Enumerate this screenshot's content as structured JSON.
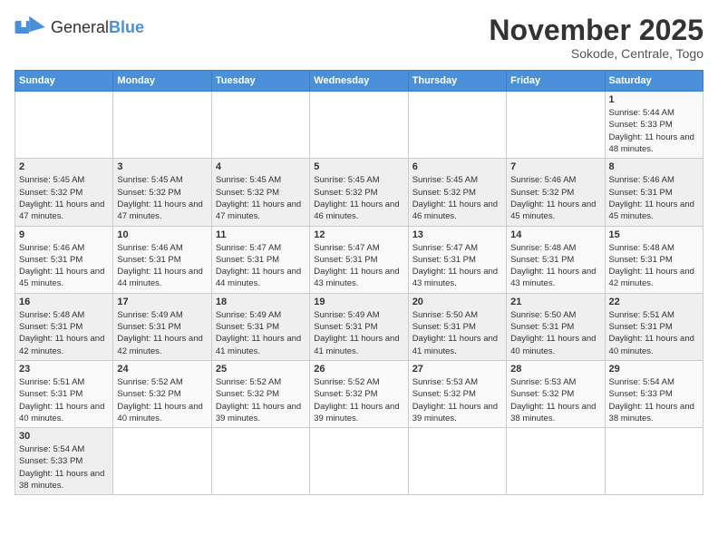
{
  "header": {
    "logo_general": "General",
    "logo_blue": "Blue",
    "month_title": "November 2025",
    "subtitle": "Sokode, Centrale, Togo"
  },
  "days_of_week": [
    "Sunday",
    "Monday",
    "Tuesday",
    "Wednesday",
    "Thursday",
    "Friday",
    "Saturday"
  ],
  "weeks": [
    [
      {
        "day": "",
        "info": ""
      },
      {
        "day": "",
        "info": ""
      },
      {
        "day": "",
        "info": ""
      },
      {
        "day": "",
        "info": ""
      },
      {
        "day": "",
        "info": ""
      },
      {
        "day": "",
        "info": ""
      },
      {
        "day": "1",
        "info": "Sunrise: 5:44 AM\nSunset: 5:33 PM\nDaylight: 11 hours and 48 minutes."
      }
    ],
    [
      {
        "day": "2",
        "info": "Sunrise: 5:45 AM\nSunset: 5:32 PM\nDaylight: 11 hours and 47 minutes."
      },
      {
        "day": "3",
        "info": "Sunrise: 5:45 AM\nSunset: 5:32 PM\nDaylight: 11 hours and 47 minutes."
      },
      {
        "day": "4",
        "info": "Sunrise: 5:45 AM\nSunset: 5:32 PM\nDaylight: 11 hours and 47 minutes."
      },
      {
        "day": "5",
        "info": "Sunrise: 5:45 AM\nSunset: 5:32 PM\nDaylight: 11 hours and 46 minutes."
      },
      {
        "day": "6",
        "info": "Sunrise: 5:45 AM\nSunset: 5:32 PM\nDaylight: 11 hours and 46 minutes."
      },
      {
        "day": "7",
        "info": "Sunrise: 5:46 AM\nSunset: 5:32 PM\nDaylight: 11 hours and 45 minutes."
      },
      {
        "day": "8",
        "info": "Sunrise: 5:46 AM\nSunset: 5:31 PM\nDaylight: 11 hours and 45 minutes."
      }
    ],
    [
      {
        "day": "9",
        "info": "Sunrise: 5:46 AM\nSunset: 5:31 PM\nDaylight: 11 hours and 45 minutes."
      },
      {
        "day": "10",
        "info": "Sunrise: 5:46 AM\nSunset: 5:31 PM\nDaylight: 11 hours and 44 minutes."
      },
      {
        "day": "11",
        "info": "Sunrise: 5:47 AM\nSunset: 5:31 PM\nDaylight: 11 hours and 44 minutes."
      },
      {
        "day": "12",
        "info": "Sunrise: 5:47 AM\nSunset: 5:31 PM\nDaylight: 11 hours and 43 minutes."
      },
      {
        "day": "13",
        "info": "Sunrise: 5:47 AM\nSunset: 5:31 PM\nDaylight: 11 hours and 43 minutes."
      },
      {
        "day": "14",
        "info": "Sunrise: 5:48 AM\nSunset: 5:31 PM\nDaylight: 11 hours and 43 minutes."
      },
      {
        "day": "15",
        "info": "Sunrise: 5:48 AM\nSunset: 5:31 PM\nDaylight: 11 hours and 42 minutes."
      }
    ],
    [
      {
        "day": "16",
        "info": "Sunrise: 5:48 AM\nSunset: 5:31 PM\nDaylight: 11 hours and 42 minutes."
      },
      {
        "day": "17",
        "info": "Sunrise: 5:49 AM\nSunset: 5:31 PM\nDaylight: 11 hours and 42 minutes."
      },
      {
        "day": "18",
        "info": "Sunrise: 5:49 AM\nSunset: 5:31 PM\nDaylight: 11 hours and 41 minutes."
      },
      {
        "day": "19",
        "info": "Sunrise: 5:49 AM\nSunset: 5:31 PM\nDaylight: 11 hours and 41 minutes."
      },
      {
        "day": "20",
        "info": "Sunrise: 5:50 AM\nSunset: 5:31 PM\nDaylight: 11 hours and 41 minutes."
      },
      {
        "day": "21",
        "info": "Sunrise: 5:50 AM\nSunset: 5:31 PM\nDaylight: 11 hours and 40 minutes."
      },
      {
        "day": "22",
        "info": "Sunrise: 5:51 AM\nSunset: 5:31 PM\nDaylight: 11 hours and 40 minutes."
      }
    ],
    [
      {
        "day": "23",
        "info": "Sunrise: 5:51 AM\nSunset: 5:31 PM\nDaylight: 11 hours and 40 minutes."
      },
      {
        "day": "24",
        "info": "Sunrise: 5:52 AM\nSunset: 5:32 PM\nDaylight: 11 hours and 40 minutes."
      },
      {
        "day": "25",
        "info": "Sunrise: 5:52 AM\nSunset: 5:32 PM\nDaylight: 11 hours and 39 minutes."
      },
      {
        "day": "26",
        "info": "Sunrise: 5:52 AM\nSunset: 5:32 PM\nDaylight: 11 hours and 39 minutes."
      },
      {
        "day": "27",
        "info": "Sunrise: 5:53 AM\nSunset: 5:32 PM\nDaylight: 11 hours and 39 minutes."
      },
      {
        "day": "28",
        "info": "Sunrise: 5:53 AM\nSunset: 5:32 PM\nDaylight: 11 hours and 38 minutes."
      },
      {
        "day": "29",
        "info": "Sunrise: 5:54 AM\nSunset: 5:33 PM\nDaylight: 11 hours and 38 minutes."
      }
    ],
    [
      {
        "day": "30",
        "info": "Sunrise: 5:54 AM\nSunset: 5:33 PM\nDaylight: 11 hours and 38 minutes."
      },
      {
        "day": "",
        "info": ""
      },
      {
        "day": "",
        "info": ""
      },
      {
        "day": "",
        "info": ""
      },
      {
        "day": "",
        "info": ""
      },
      {
        "day": "",
        "info": ""
      },
      {
        "day": "",
        "info": ""
      }
    ]
  ]
}
